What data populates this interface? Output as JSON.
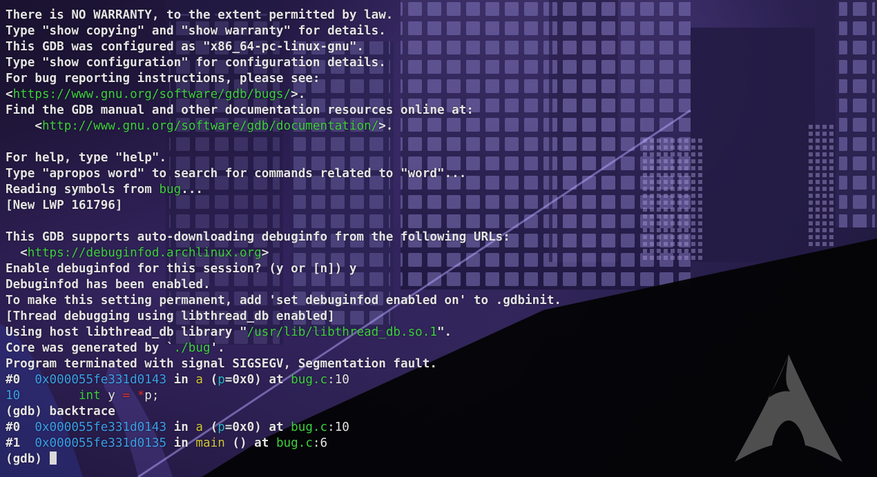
{
  "terminal": {
    "lines": [
      [
        {
          "t": "There is NO WARRANTY, to the extent permitted by law."
        }
      ],
      [
        {
          "t": "Type \"show copying\" and \"show warranty\" for details."
        }
      ],
      [
        {
          "t": "This GDB was configured as \"x86_64-pc-linux-gnu\"."
        }
      ],
      [
        {
          "t": "Type \"show configuration\" for configuration details."
        }
      ],
      [
        {
          "t": "For bug reporting instructions, please see:"
        }
      ],
      [
        {
          "t": "<"
        },
        {
          "t": "https://www.gnu.org/software/gdb/bugs/",
          "c": "url"
        },
        {
          "t": ">."
        }
      ],
      [
        {
          "t": "Find the GDB manual and other documentation resources online at:"
        }
      ],
      [
        {
          "t": "    <"
        },
        {
          "t": "http://www.gnu.org/software/gdb/documentation/",
          "c": "url"
        },
        {
          "t": ">."
        }
      ],
      [],
      [
        {
          "t": "For help, type \"help\"."
        }
      ],
      [
        {
          "t": "Type \"apropos word\" to search for commands related to \"word\"..."
        }
      ],
      [
        {
          "t": "Reading symbols from "
        },
        {
          "t": "bug",
          "c": "file"
        },
        {
          "t": "..."
        }
      ],
      [
        {
          "t": "[New LWP 161796]"
        }
      ],
      [],
      [
        {
          "t": "This GDB supports auto-downloading debuginfo from the following URLs:"
        }
      ],
      [
        {
          "t": "  <"
        },
        {
          "t": "https://debuginfod.archlinux.org",
          "c": "url"
        },
        {
          "t": ">"
        }
      ],
      [
        {
          "t": "Enable debuginfod for this session? (y or [n]) y"
        }
      ],
      [
        {
          "t": "Debuginfod has been enabled."
        }
      ],
      [
        {
          "t": "To make this setting permanent, add 'set debuginfod enabled on' to .gdbinit."
        }
      ],
      [
        {
          "t": "[Thread debugging using libthread_db enabled]"
        }
      ],
      [
        {
          "t": "Using host libthread_db library \""
        },
        {
          "t": "/usr/lib/libthread_db.so.1",
          "c": "file"
        },
        {
          "t": "\"."
        }
      ],
      [
        {
          "t": "Core was generated by `"
        },
        {
          "t": "./bug",
          "c": "file"
        },
        {
          "t": "'."
        }
      ],
      [
        {
          "t": "Program terminated with signal SIGSEGV, Segmentation fault."
        }
      ],
      [
        {
          "t": "#0  "
        },
        {
          "t": "0x000055fe331d0143",
          "c": "addr"
        },
        {
          "t": " in "
        },
        {
          "t": "a",
          "c": "fn"
        },
        {
          "t": " ("
        },
        {
          "t": "p",
          "c": "var"
        },
        {
          "t": "=0x0) at "
        },
        {
          "t": "bug.c",
          "c": "file"
        },
        {
          "t": ":10",
          "c": "n"
        }
      ],
      [
        {
          "t": "10",
          "c": "lineno"
        },
        {
          "t": "        ",
          "c": "n"
        },
        {
          "t": "int",
          "c": "kw"
        },
        {
          "t": " y ",
          "c": "n"
        },
        {
          "t": "=",
          "c": "op"
        },
        {
          "t": " ",
          "c": "n"
        },
        {
          "t": "*",
          "c": "op"
        },
        {
          "t": "p;",
          "c": "n"
        }
      ],
      [
        {
          "t": "(gdb) backtrace"
        }
      ],
      [
        {
          "t": "#0  "
        },
        {
          "t": "0x000055fe331d0143",
          "c": "addr"
        },
        {
          "t": " in "
        },
        {
          "t": "a",
          "c": "fn"
        },
        {
          "t": " ("
        },
        {
          "t": "p",
          "c": "var"
        },
        {
          "t": "=0x0) at "
        },
        {
          "t": "bug.c",
          "c": "file"
        },
        {
          "t": ":10",
          "c": "n"
        }
      ],
      [
        {
          "t": "#1  "
        },
        {
          "t": "0x000055fe331d0135",
          "c": "addr"
        },
        {
          "t": " in "
        },
        {
          "t": "main",
          "c": "fn"
        },
        {
          "t": " () at "
        },
        {
          "t": "bug.c",
          "c": "file"
        },
        {
          "t": ":6",
          "c": "n"
        }
      ]
    ],
    "prompt": "(gdb) ",
    "input_value": ""
  },
  "background": {
    "logo_icon": "arch-linux-logo-icon"
  },
  "colors": {
    "text": "#e4e4e4",
    "url_green": "#3ecf3e",
    "address_blue": "#3aa0e8",
    "function_yellow": "#cfc63a",
    "variable_cyan": "#29b8c8",
    "operator_red": "#e03030"
  }
}
